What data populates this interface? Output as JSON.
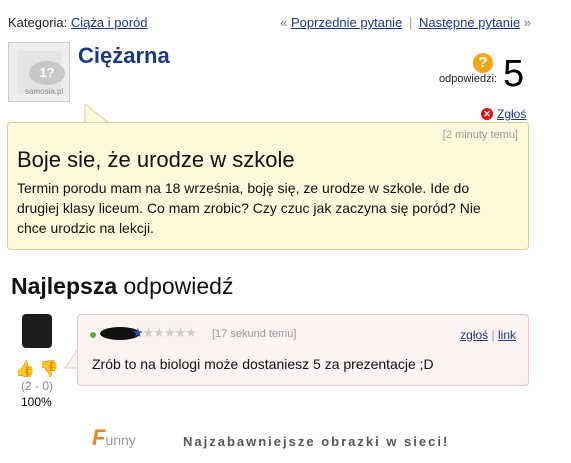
{
  "category": {
    "label": "Kategoria:",
    "value": "Ciąża i poród"
  },
  "nav": {
    "prev_arrow": "«",
    "prev": "Poprzednie pytanie",
    "separator": "|",
    "next": "Następne pytanie",
    "next_arrow": "»"
  },
  "asker": {
    "name": "Ciężarna",
    "avatar_text": "1?",
    "avatar_site": "samosia.pl"
  },
  "answers": {
    "icon": "?",
    "label": "odpowiedzi:",
    "count": "5"
  },
  "report": {
    "label": "Zgłoś",
    "icon": "x-circle-icon"
  },
  "question": {
    "time": "[2 minuty temu]",
    "title": "Boje sie, że urodze w szkole",
    "body": "Termin porodu mam na 18 września, boję się, ze urodze w szkole. Ide do drugiej klasy liceum. Co mam zrobic? Czy czuc jak zaczyna się poród? Nie chce urodzic na lekcji."
  },
  "best_answer": {
    "heading_bold": "Najlepsza",
    "heading_rest": "odpowiedź",
    "time": "[17 sekund temu]",
    "report": "zgłoś",
    "sep": "|",
    "link": "link",
    "text": "Zrób to na biologi może dostaniesz 5 za prezentacje ;D",
    "rating_stars": 1,
    "stars_total": 6,
    "votes": "(2 - 0)",
    "percent": "100%"
  },
  "footer": {
    "logo_main": "F",
    "logo_rest": "unny",
    "slogan": "Najzabawniejsze obrazki w sieci!"
  },
  "colors": {
    "link": "#1a3a8c",
    "question_bg": "#fff9dc",
    "answer_bg": "#fdf2f2",
    "username": "#1a3a7a"
  }
}
